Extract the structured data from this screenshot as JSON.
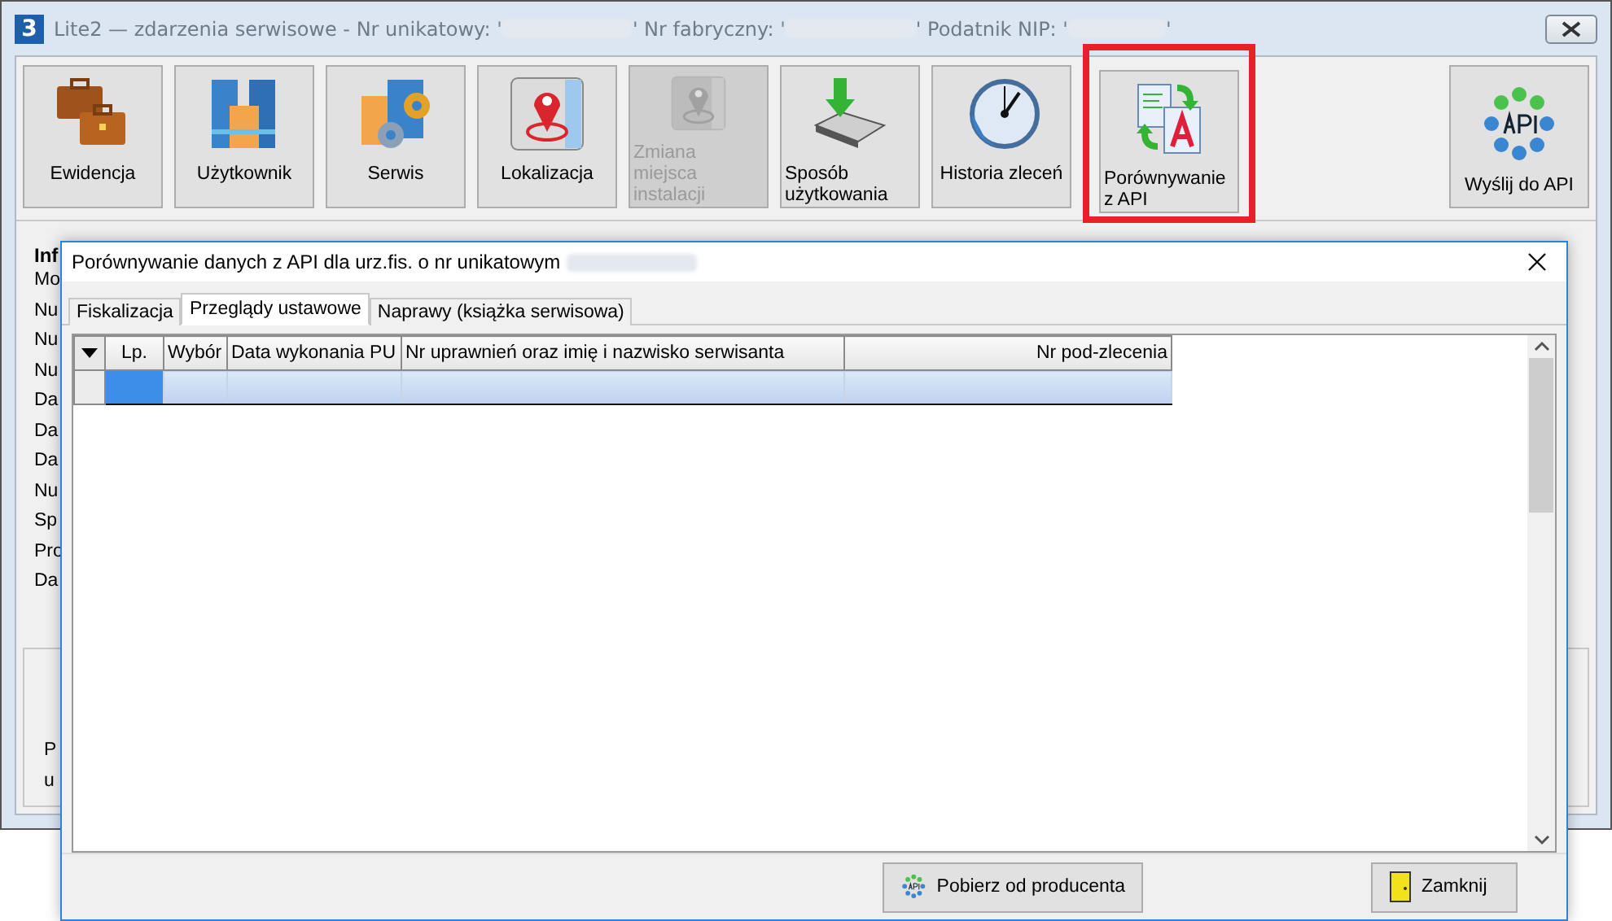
{
  "window": {
    "app_badge": "3",
    "title_parts": [
      "Lite2 — zdarzenia serwisowe - Nr unikatowy: '",
      "' Nr fabryczny: '",
      "' Podatnik NIP: '",
      "'"
    ]
  },
  "toolbar": [
    {
      "label": "Ewidencja",
      "kind": "cases",
      "disabled": false,
      "highlighted": false
    },
    {
      "label": "Użytkownik",
      "kind": "buildings",
      "disabled": false,
      "highlighted": false
    },
    {
      "label": "Serwis",
      "kind": "service",
      "disabled": false,
      "highlighted": false
    },
    {
      "label": "Lokalizacja",
      "kind": "map",
      "disabled": false,
      "highlighted": false
    },
    {
      "label": "Zmiana miejsca instalacji",
      "kind": "map",
      "disabled": true,
      "highlighted": false
    },
    {
      "label": "Sposób użytkowania",
      "kind": "download",
      "disabled": false,
      "highlighted": false
    },
    {
      "label": "Historia zleceń",
      "kind": "clock",
      "disabled": false,
      "highlighted": false
    },
    {
      "label": "Porównywanie z API",
      "kind": "compare",
      "disabled": false,
      "highlighted": true
    }
  ],
  "api_button": {
    "label": "Wyślij do API"
  },
  "info_panel": {
    "heading": "Inf",
    "labels": [
      "Mo",
      "Nu",
      "Nu",
      "Nu",
      "Da",
      "Da",
      "Da",
      "Nu",
      "Sp",
      "Pro",
      "Da"
    ]
  },
  "bottom_panel": {
    "labels": [
      "P",
      "u"
    ]
  },
  "dialog": {
    "title": "Porównywanie danych z API dla urz.fis. o nr unikatowym",
    "tabs": [
      {
        "label": "Fiskalizacja",
        "selected": false
      },
      {
        "label": "Przeglądy ustawowe",
        "selected": true
      },
      {
        "label": "Naprawy  (książka serwisowa)",
        "selected": false
      }
    ],
    "table": {
      "columns": [
        {
          "label": "Lp."
        },
        {
          "label": "Wybór"
        },
        {
          "label": "Data wykonania PU"
        },
        {
          "label": "Nr uprawnień oraz imię i nazwisko serwisanta"
        },
        {
          "label": "Nr pod-zlecenia"
        }
      ],
      "rows": [
        {
          "selected": true
        }
      ]
    },
    "buttons": [
      {
        "label": "Pobierz od producenta",
        "kind": "api"
      },
      {
        "label": "Zamknij",
        "kind": "door"
      }
    ]
  }
}
